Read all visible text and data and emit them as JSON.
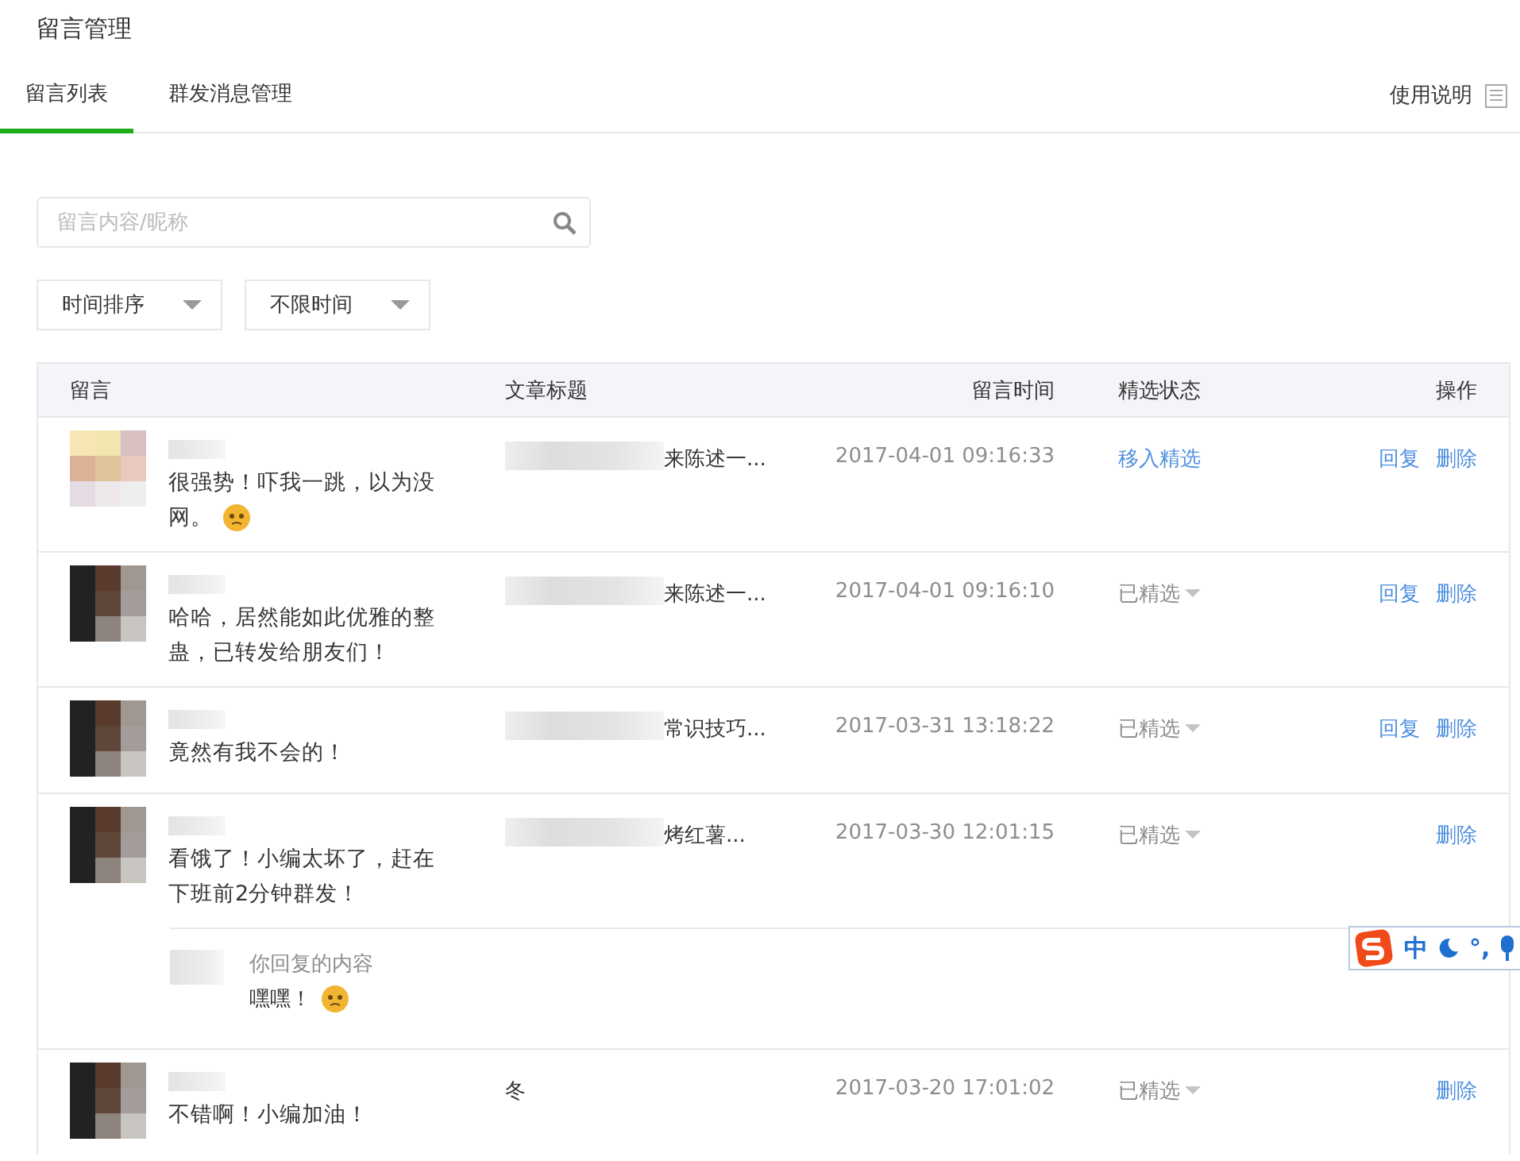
{
  "page_title": "留言管理",
  "tabs": [
    {
      "label": "留言列表",
      "selected": true
    },
    {
      "label": "群发消息管理",
      "selected": false
    }
  ],
  "help_link": "使用说明",
  "search": {
    "placeholder": "留言内容/昵称"
  },
  "filters": [
    "时间排序",
    "不限时间"
  ],
  "table": {
    "columns": [
      "留言",
      "文章标题",
      "留言时间",
      "精选状态",
      "操作"
    ],
    "rows": [
      {
        "text": "很强势！吓我一跳，以为没网。",
        "has_emoji": true,
        "title": "来陈述一...",
        "title_blurred": true,
        "time": "2017-04-01 09:16:33",
        "status": {
          "kind": "link",
          "label": "移入精选"
        },
        "actions": [
          "回复",
          "删除"
        ]
      },
      {
        "text": "哈哈，居然能如此优雅的整蛊，已转发给朋友们！",
        "has_emoji": false,
        "title": "来陈述一...",
        "title_blurred": true,
        "time": "2017-04-01 09:16:10",
        "status": {
          "kind": "dropdown",
          "label": "已精选"
        },
        "actions": [
          "回复",
          "删除"
        ]
      },
      {
        "text": "竟然有我不会的！",
        "has_emoji": false,
        "title": "常识技巧...",
        "title_blurred": true,
        "time": "2017-03-31 13:18:22",
        "status": {
          "kind": "dropdown",
          "label": "已精选"
        },
        "actions": [
          "回复",
          "删除"
        ]
      },
      {
        "text": "看饿了！小编太坏了，赶在下班前2分钟群发！",
        "has_emoji": false,
        "title": "烤红薯...",
        "title_blurred": true,
        "time": "2017-03-30 12:01:15",
        "status": {
          "kind": "dropdown",
          "label": "已精选"
        },
        "actions": [
          "删除"
        ],
        "reply": {
          "label": "你回复的内容",
          "text": "嘿嘿！",
          "has_emoji": true
        }
      },
      {
        "text": "不错啊！小编加油！",
        "has_emoji": false,
        "title": "冬",
        "title_blurred": false,
        "time": "2017-03-20 17:01:02",
        "status": {
          "kind": "dropdown",
          "label": "已精选"
        },
        "actions": [
          "删除"
        ]
      }
    ]
  },
  "ime_toolbar": {
    "labels": [
      "中",
      "°,"
    ]
  }
}
